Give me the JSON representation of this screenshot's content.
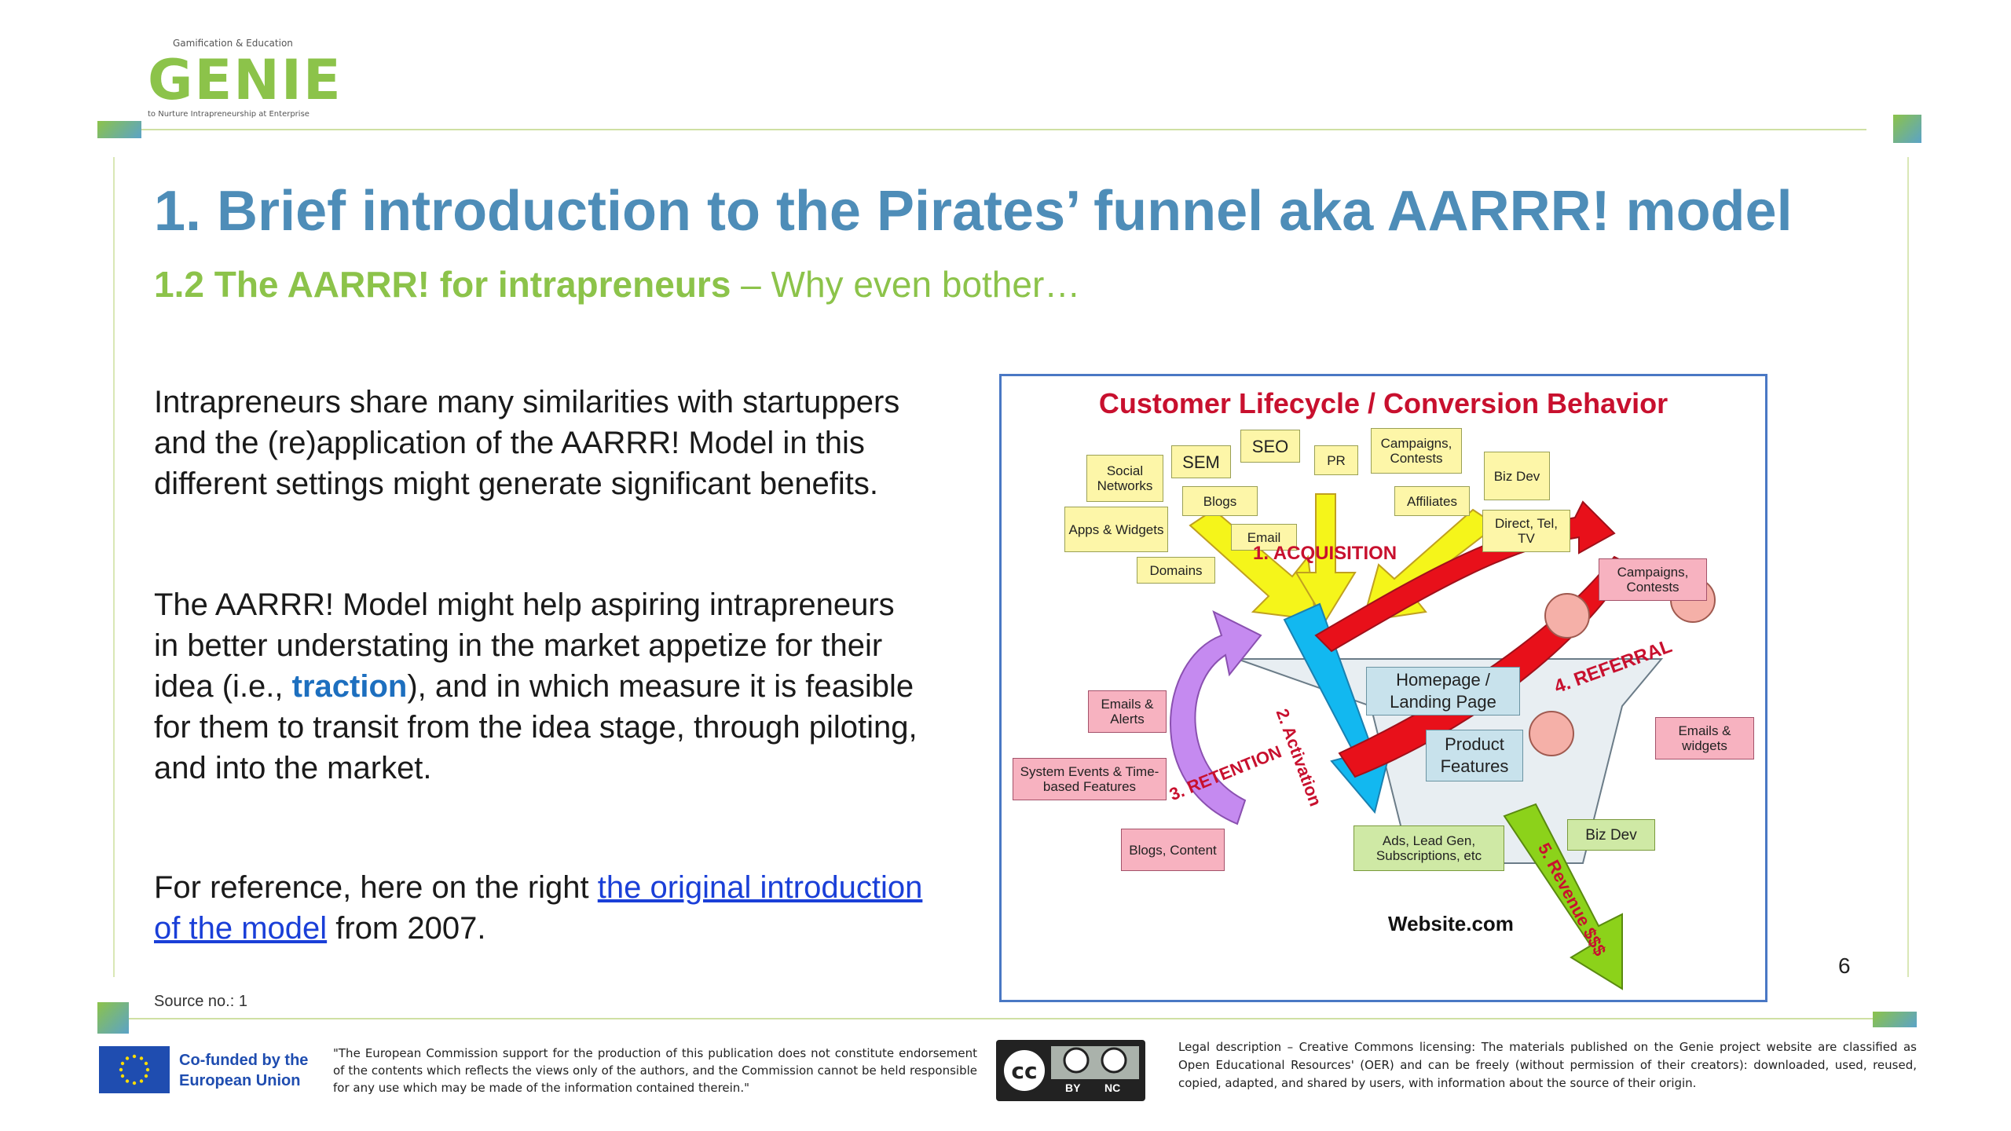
{
  "logo": {
    "top_text": "Gamification & Education",
    "word": "GENIE",
    "tagline": "to Nurture Intrapreneurship at Enterprise"
  },
  "title": "1. Brief introduction to the Pirates’ funnel aka AARRR! model",
  "subtitle": {
    "bold": "1.2 The AARRR! for intrapreneurs",
    "rest": " – Why even bother…"
  },
  "body": {
    "para1": "Intrapreneurs share many similarities with startuppers and the (re)application of the AARRR! Model in this different settings might generate significant benefits.",
    "para2_before": "The AARRR! Model might help aspiring intrapreneurs in better understating in the market appetize for their idea (i.e., ",
    "para2_highlight": "traction",
    "para2_after": "), and in which measure it is feasible for them to transit from the idea stage, through piloting, and into the market.",
    "para3_before": "For reference, here on the right ",
    "para3_link": "the original introduction of the model",
    "para3_after": " from 2007."
  },
  "source": "Source no.: 1",
  "page_number": "6",
  "diagram": {
    "title": "Customer Lifecycle / Conversion Behavior",
    "acquisition_sources": [
      "Social Networks",
      "SEM",
      "SEO",
      "PR",
      "Campaigns, Contests",
      "Biz Dev",
      "Blogs",
      "Affiliates",
      "Apps & Widgets",
      "Email",
      "Direct, Tel, TV",
      "Domains"
    ],
    "stages": [
      "1. ACQUISITION",
      "2. Activation",
      "3. RETENTION",
      "4. REFERRAL",
      "5. Revenue $$$"
    ],
    "retention_items": [
      "Emails & Alerts",
      "System Events & Time-based Features",
      "Blogs, Content"
    ],
    "referral_items": [
      "Campaigns, Contests",
      "Emails & widgets"
    ],
    "funnel_items": [
      "Homepage / Landing Page",
      "Product Features",
      "Ads, Lead Gen, Subscriptions, etc",
      "Biz Dev"
    ],
    "website": "Website.com"
  },
  "footer": {
    "eu_text": "Co-funded by the European Union",
    "disclaimer": "\"The European Commission support for the production of this publication does not constitute endorsement of the contents which reflects the views only of the authors, and the Commission cannot be held responsible for any use which may be made of the information contained therein.\"",
    "cc_labels": [
      "BY",
      "NC"
    ],
    "legal": "Legal description – Creative Commons licensing: The materials published on the Genie project website are classified as Open Educational Resources' (OER) and can be freely (without permission of their creators): downloaded, used, reused, copied, adapted, and shared by users, with information about the source of their origin."
  },
  "colors": {
    "title_blue": "#4e8db8",
    "subtitle_green": "#8cc34a",
    "traction_blue": "#1d6fbf",
    "link_blue": "#1a3fd8",
    "diagram_red": "#c8102e"
  }
}
